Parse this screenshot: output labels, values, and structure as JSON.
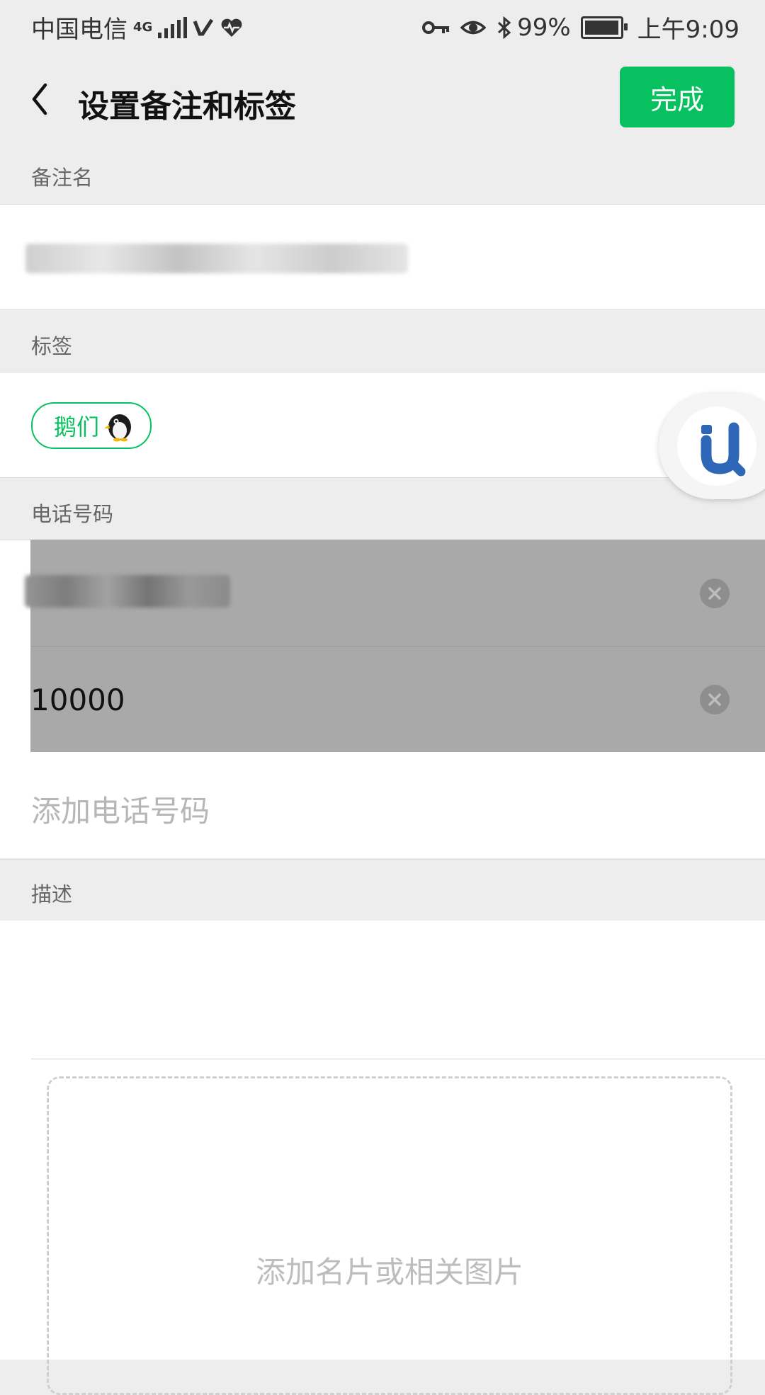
{
  "status_bar": {
    "carrier": "中国电信",
    "network": "4G",
    "battery": "99%",
    "battery_level": 0.99,
    "time": "上午9:09"
  },
  "header": {
    "title": "设置备注和标签",
    "done_label": "完成"
  },
  "remark": {
    "section_label": "备注名"
  },
  "tags": {
    "section_label": "标签",
    "items": [
      "鹅们"
    ]
  },
  "phones": {
    "section_label": "电话号码",
    "numbers": [
      "",
      "10000"
    ],
    "add_label": "添加电话号码"
  },
  "description": {
    "section_label": "描述",
    "upload_label": "添加名片或相关图片"
  },
  "colors": {
    "accent": "#07c160",
    "background": "#ededed",
    "assistant_blue": "#2f67b8"
  }
}
